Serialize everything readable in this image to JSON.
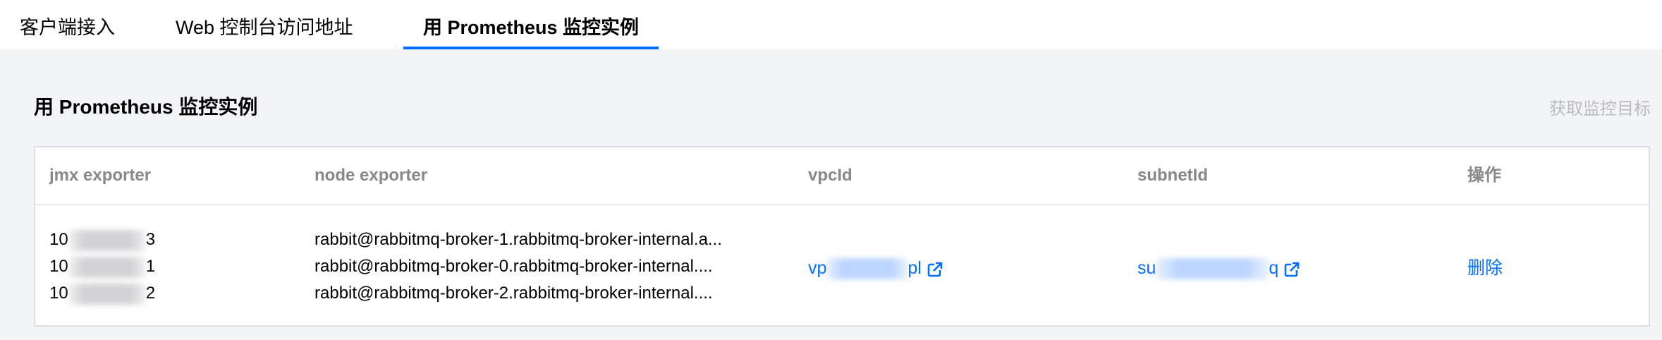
{
  "tabs": [
    {
      "label": "客户端接入",
      "active": false
    },
    {
      "label": "Web 控制台访问地址",
      "active": false
    },
    {
      "label": "用 Prometheus 监控实例",
      "active": true
    }
  ],
  "section": {
    "title": "用 Prometheus 监控实例",
    "fetch_action": "获取监控目标"
  },
  "table": {
    "columns": [
      "jmx exporter",
      "node exporter",
      "vpcId",
      "subnetId",
      "操作"
    ],
    "row": {
      "jmx_exporter": [
        {
          "prefix": "10",
          "suffix": "3"
        },
        {
          "prefix": "10",
          "suffix": "1"
        },
        {
          "prefix": "10",
          "suffix": "2"
        }
      ],
      "node_exporter": [
        "rabbit@rabbitmq-broker-1.rabbitmq-broker-internal.a...",
        "rabbit@rabbitmq-broker-0.rabbitmq-broker-internal....",
        "rabbit@rabbitmq-broker-2.rabbitmq-broker-internal...."
      ],
      "vpc": {
        "prefix": "vp",
        "suffix": "pl",
        "icon": "external-link-icon"
      },
      "subnet": {
        "prefix": "su",
        "suffix": "q",
        "icon": "external-link-icon"
      },
      "action": "删除"
    }
  },
  "colors": {
    "accent": "#006eff",
    "muted_header": "#888888",
    "disabled": "#bbbbbb",
    "background": "#f3f4f7"
  }
}
